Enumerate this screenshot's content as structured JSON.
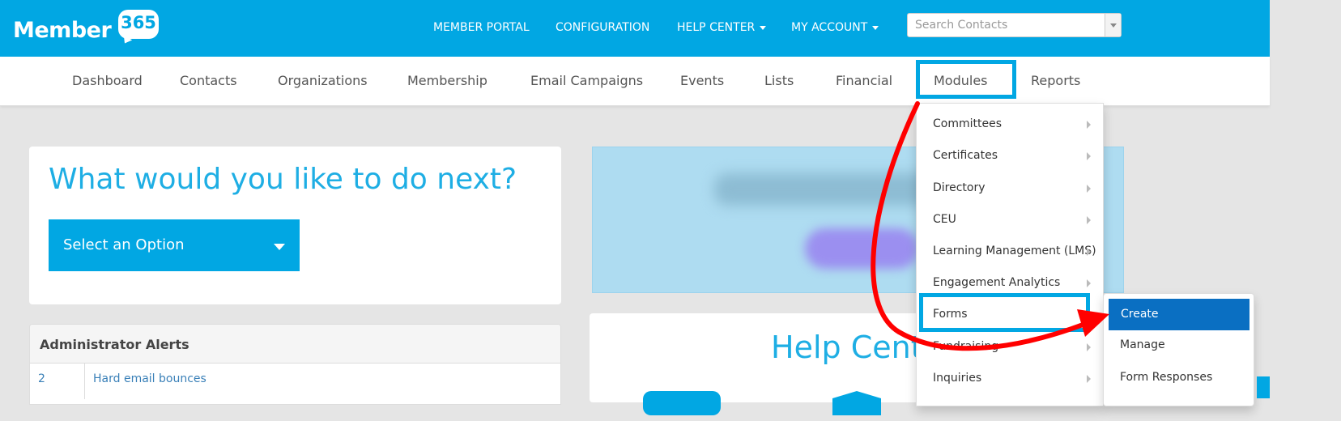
{
  "logo": {
    "text": "Member",
    "number": "365"
  },
  "topnav": {
    "member_portal": "MEMBER PORTAL",
    "configuration": "CONFIGURATION",
    "help_center": "HELP CENTER",
    "my_account": "MY ACCOUNT"
  },
  "search": {
    "placeholder": "Search Contacts"
  },
  "subnav": {
    "dashboard": "Dashboard",
    "contacts": "Contacts",
    "organizations": "Organizations",
    "membership": "Membership",
    "email_campaigns": "Email Campaigns",
    "events": "Events",
    "lists": "Lists",
    "financial": "Financial",
    "modules": "Modules",
    "reports": "Reports"
  },
  "next": {
    "heading": "What would you like to do next?",
    "select": "Select an Option"
  },
  "alerts": {
    "title": "Administrator Alerts",
    "rows": [
      {
        "count": "2",
        "label": "Hard email bounces"
      }
    ]
  },
  "help": {
    "title": "Help Center"
  },
  "modules_menu": {
    "items": [
      "Committees",
      "Certificates",
      "Directory",
      "CEU",
      "Learning Management (LMS)",
      "Engagement Analytics",
      "Forms",
      "Fundraising",
      "Inquiries"
    ]
  },
  "forms_submenu": {
    "items": [
      "Create",
      "Manage",
      "Form Responses"
    ]
  },
  "colors": {
    "brand": "#01a7e3",
    "active": "#0a6fc2",
    "annotation": "#ff0000"
  }
}
